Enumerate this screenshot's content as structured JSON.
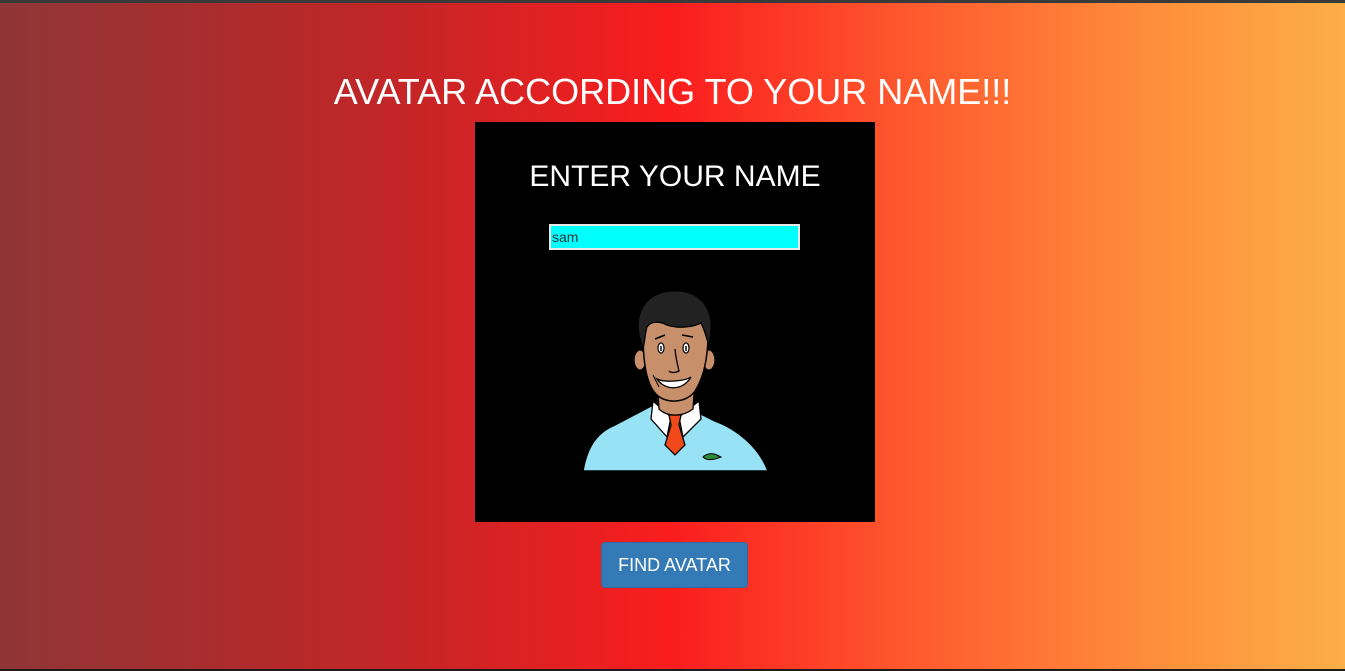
{
  "page": {
    "title": "AVATAR ACCORDING TO YOUR NAME!!!"
  },
  "card": {
    "heading": "ENTER YOUR NAME",
    "name_input_value": "sam"
  },
  "avatar": {
    "icon": "man-with-tie-avatar",
    "skin_color": "#c8906a",
    "shirt_color": "#98e2f5",
    "tie_color": "#f04a1a"
  },
  "actions": {
    "find_label": "FIND AVATAR"
  },
  "colors": {
    "card_background": "#000000",
    "input_background": "#00ffff",
    "button_background": "#337ab7"
  }
}
